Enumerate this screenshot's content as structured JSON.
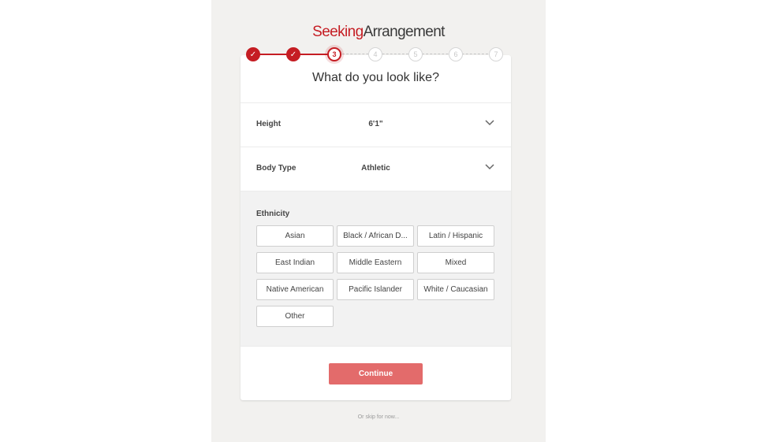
{
  "brand": {
    "part1": "Seeking",
    "part2": "Arrangement"
  },
  "progress": {
    "steps": [
      "✓",
      "✓",
      "3",
      "4",
      "5",
      "6",
      "7"
    ],
    "current": 3
  },
  "card": {
    "title": "What do you look like?",
    "height": {
      "label": "Height",
      "value": "6'1\""
    },
    "body_type": {
      "label": "Body Type",
      "value": "Athletic"
    },
    "ethnicity": {
      "label": "Ethnicity",
      "options": [
        "Asian",
        "Black / African D...",
        "Latin / Hispanic",
        "East Indian",
        "Middle Eastern",
        "Mixed",
        "Native American",
        "Pacific Islander",
        "White / Caucasian",
        "Other"
      ]
    },
    "continue_label": "Continue"
  },
  "skip_label": "Or skip for now...",
  "colors": {
    "brand": "#c51d23",
    "button": "#e36b6b"
  }
}
